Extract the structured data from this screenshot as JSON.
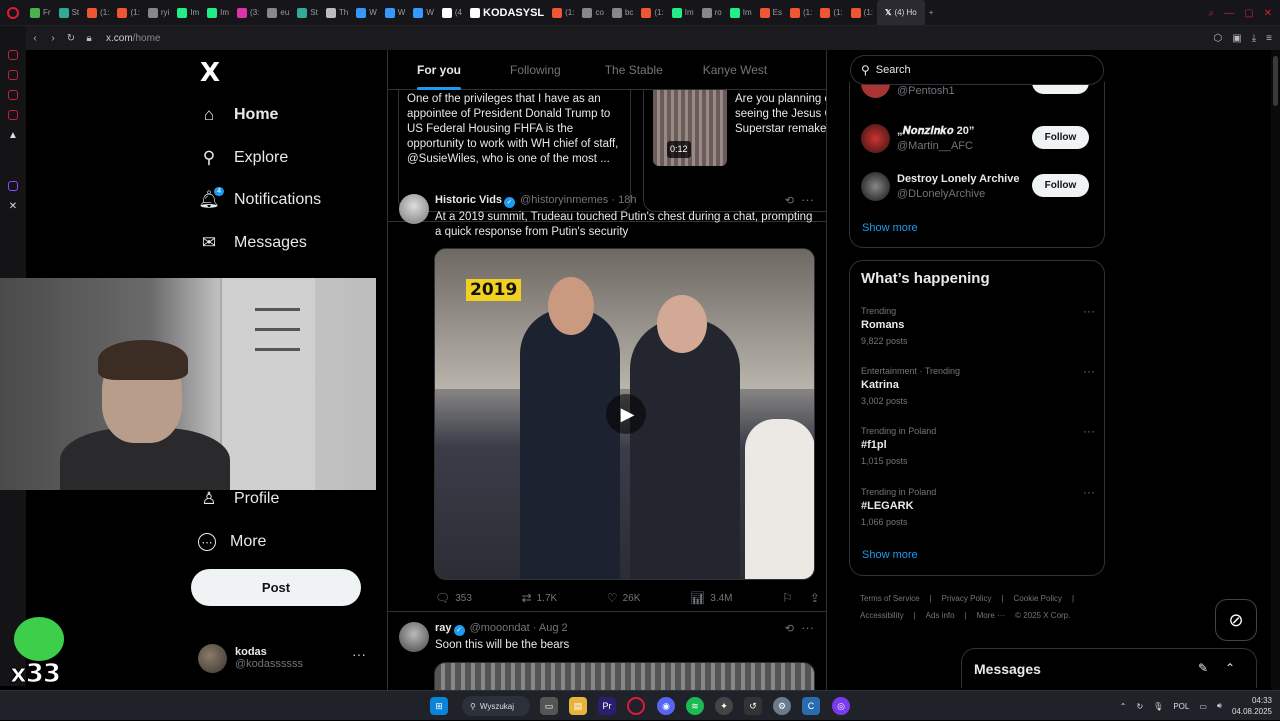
{
  "browser": {
    "tabs": [
      "Fr",
      "St",
      "(1:",
      "(1:",
      "ryi",
      "Im",
      "Im",
      "(3:",
      "eu",
      "St",
      "Th",
      "W",
      "W",
      "W",
      "(4",
      "KODASYSL",
      "(1:",
      "co",
      "bc",
      "(1:",
      "Im",
      "ro",
      "Im",
      "Es",
      "(1:",
      "(1:",
      "(1:"
    ],
    "active_tab": "(4) Ho",
    "url_host": "x.com",
    "url_path": "/home",
    "new_tab": "+"
  },
  "nav": {
    "logo": "X",
    "items": [
      {
        "label": "Home",
        "icon": "home-icon",
        "glyph": "⌂"
      },
      {
        "label": "Explore",
        "icon": "search-icon",
        "glyph": "⚲"
      },
      {
        "label": "Notifications",
        "icon": "bell-icon",
        "glyph": "🔔︎"
      },
      {
        "label": "Messages",
        "icon": "envelope-icon",
        "glyph": "✉"
      },
      {
        "label": "Profile",
        "icon": "person-icon",
        "glyph": "♙"
      },
      {
        "label": "More",
        "icon": "more-circle-icon",
        "glyph": "⋯"
      }
    ],
    "notifications_badge": "4",
    "post_label": "Post",
    "account": {
      "name": "kodas",
      "handle": "@kodassssss",
      "more": "···"
    }
  },
  "overlay": {
    "emote_text": "x33"
  },
  "timeline": {
    "tabs": [
      "For you",
      "Following",
      "The Stable",
      "Kanye West"
    ],
    "active_tab": 0,
    "quote1_text": "One of the privileges that I have as an appointee of President Donald Trump to US Federal Housing FHFA is the opportunity to work with WH chief of staff, @SusieWiles, who is one of the most ...",
    "quote2_text": "Are you planning o seeing the Jesus C Superstar remake?",
    "quote2_duration": "0:12",
    "tweet1": {
      "name": "Historic Vids",
      "handle": "@historyinmemes",
      "time": "· 18h",
      "text": "At a 2019 summit, Trudeau touched Putin's chest during a chat, prompting a quick response from Putin's security",
      "video_label": "2019",
      "replies": "353",
      "reposts": "1.7K",
      "likes": "26K",
      "views": "3.4M"
    },
    "tweet2": {
      "name": "ray",
      "handle": "@mooondat",
      "time": "· Aug 2",
      "text": "Soon this will be the bears"
    }
  },
  "right": {
    "search_placeholder": "Search",
    "who_to_follow": [
      {
        "name": "",
        "handle": "@Pentosh1",
        "button": "Follow"
      },
      {
        "name": "„𝑵𝒐𝒏𝒛𝒊𝒏𝒌𝒐 20”",
        "handle": "@Martin__AFC",
        "button": "Follow"
      },
      {
        "name": "Destroy Lonely Archive",
        "handle": "@DLonelyArchive",
        "button": "Follow"
      }
    ],
    "show_more": "Show more",
    "happening_title": "What’s happening",
    "trends": [
      {
        "context": "Trending",
        "title": "Romans",
        "count": "9,822 posts"
      },
      {
        "context": "Entertainment · Trending",
        "title": "Katrina",
        "count": "3,002 posts"
      },
      {
        "context": "Trending in Poland",
        "title": "#f1pl",
        "count": "1,015 posts"
      },
      {
        "context": "Trending in Poland",
        "title": "#LEGARK",
        "count": "1,066 posts"
      }
    ],
    "footer_links": [
      "Terms of Service",
      "|",
      "Privacy Policy",
      "|",
      "Cookie Policy",
      "|",
      "Accessibility",
      "|",
      "Ads info",
      "|",
      "More ···",
      "© 2025 X Corp."
    ],
    "messages_title": "Messages"
  },
  "taskbar": {
    "search_label": "Wyszukaj",
    "language": "POL",
    "time": "04:33",
    "date": "04.08.2025"
  }
}
